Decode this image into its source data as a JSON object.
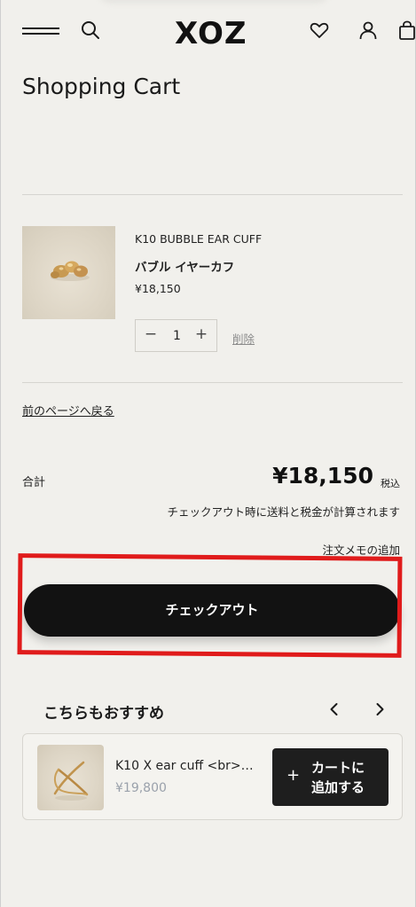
{
  "header": {
    "logo": "XOZ",
    "icons": [
      "menu-icon",
      "search-icon",
      "heart-icon",
      "account-icon",
      "bag-icon"
    ]
  },
  "page": {
    "title": "Shopping Cart"
  },
  "cart": {
    "item": {
      "sku": "K10 BUBBLE EAR CUFF",
      "name": "バブル イヤーカフ",
      "price": "¥18,150",
      "quantity": "1",
      "minus": "−",
      "plus": "+",
      "remove_label": "削除"
    },
    "back_link": "前のページへ戻る",
    "total_label": "合計",
    "total_amount": "¥18,150",
    "tax_label": "税込",
    "tax_note": "チェックアウト時に送料と税金が計算されます",
    "memo_link": "注文メモの追加",
    "checkout_label": "チェックアウト"
  },
  "recommend": {
    "title": "こちらもおすすめ",
    "item": {
      "name": "K10 X ear cuff <br>…",
      "price": "¥19,800",
      "add_plus": "+",
      "add_label_line1": "カートに",
      "add_label_line2": "追加する"
    }
  },
  "colors": {
    "background": "#f1f0ec",
    "button": "#121212",
    "highlight": "#e01b1b",
    "muted_price": "#9aa1ab"
  }
}
